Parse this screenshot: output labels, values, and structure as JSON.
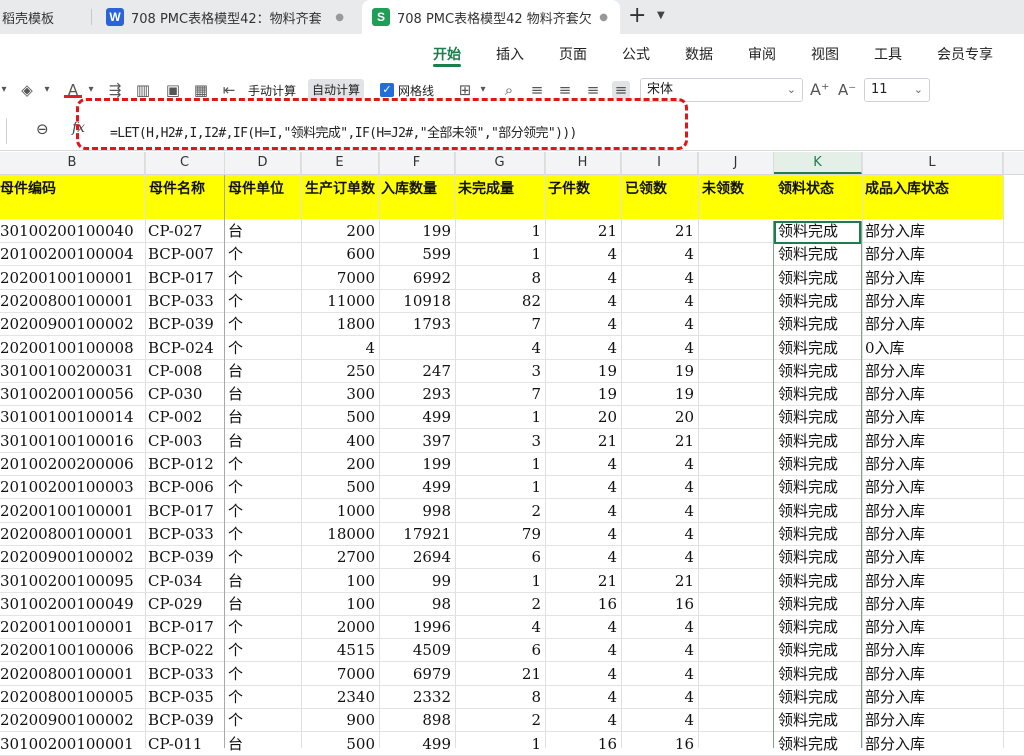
{
  "tabs": [
    {
      "label": "稻壳模板",
      "badge": "",
      "active": false
    },
    {
      "label": "708 PMC表格模型42：物料齐套",
      "badge": "W",
      "badge_color": "#2b63d9",
      "active": false
    },
    {
      "label": "708 PMC表格模型42 物料齐套欠",
      "badge": "S",
      "badge_color": "#1e9e57",
      "active": true
    }
  ],
  "menu": [
    "开始",
    "插入",
    "页面",
    "公式",
    "数据",
    "审阅",
    "视图",
    "工具",
    "会员专享"
  ],
  "toolbar": {
    "manual_calc": "手动计算",
    "auto_calc": "自动计算",
    "gridlines": "网格线",
    "font_name": "宋体",
    "font_size": "11"
  },
  "formula": "=LET(H,H2#,I,I2#,IF(H=I,\"领料完成\",IF(H=J2#,\"全部未领\",\"部分领完\")))",
  "columns": [
    "B",
    "C",
    "D",
    "E",
    "F",
    "G",
    "H",
    "I",
    "J",
    "K",
    "L"
  ],
  "selected_column": "K",
  "headers": [
    "母件编码",
    "母件名称",
    "母件单位",
    "生产订单数",
    "入库数量",
    "未完成量",
    "子件数",
    "已领数",
    "未领数",
    "领料状态",
    "成品入库状态"
  ],
  "rows": [
    [
      "30100200100040",
      "CP-027",
      "台",
      "200",
      "199",
      "1",
      "21",
      "21",
      "",
      "领料完成",
      "部分入库"
    ],
    [
      "20100200100004",
      "BCP-007",
      "个",
      "600",
      "599",
      "1",
      "4",
      "4",
      "",
      "领料完成",
      "部分入库"
    ],
    [
      "20200100100001",
      "BCP-017",
      "个",
      "7000",
      "6992",
      "8",
      "4",
      "4",
      "",
      "领料完成",
      "部分入库"
    ],
    [
      "20200800100001",
      "BCP-033",
      "个",
      "11000",
      "10918",
      "82",
      "4",
      "4",
      "",
      "领料完成",
      "部分入库"
    ],
    [
      "20200900100002",
      "BCP-039",
      "个",
      "1800",
      "1793",
      "7",
      "4",
      "4",
      "",
      "领料完成",
      "部分入库"
    ],
    [
      "20200100100008",
      "BCP-024",
      "个",
      "4",
      "",
      "4",
      "4",
      "4",
      "",
      "领料完成",
      "0入库"
    ],
    [
      "30100100200031",
      "CP-008",
      "台",
      "250",
      "247",
      "3",
      "19",
      "19",
      "",
      "领料完成",
      "部分入库"
    ],
    [
      "30100200100056",
      "CP-030",
      "台",
      "300",
      "293",
      "7",
      "19",
      "19",
      "",
      "领料完成",
      "部分入库"
    ],
    [
      "30100100100014",
      "CP-002",
      "台",
      "500",
      "499",
      "1",
      "20",
      "20",
      "",
      "领料完成",
      "部分入库"
    ],
    [
      "30100100100016",
      "CP-003",
      "台",
      "400",
      "397",
      "3",
      "21",
      "21",
      "",
      "领料完成",
      "部分入库"
    ],
    [
      "20100200200006",
      "BCP-012",
      "个",
      "200",
      "199",
      "1",
      "4",
      "4",
      "",
      "领料完成",
      "部分入库"
    ],
    [
      "20100200100003",
      "BCP-006",
      "个",
      "500",
      "499",
      "1",
      "4",
      "4",
      "",
      "领料完成",
      "部分入库"
    ],
    [
      "20200100100001",
      "BCP-017",
      "个",
      "1000",
      "998",
      "2",
      "4",
      "4",
      "",
      "领料完成",
      "部分入库"
    ],
    [
      "20200800100001",
      "BCP-033",
      "个",
      "18000",
      "17921",
      "79",
      "4",
      "4",
      "",
      "领料完成",
      "部分入库"
    ],
    [
      "20200900100002",
      "BCP-039",
      "个",
      "2700",
      "2694",
      "6",
      "4",
      "4",
      "",
      "领料完成",
      "部分入库"
    ],
    [
      "30100200100095",
      "CP-034",
      "台",
      "100",
      "99",
      "1",
      "21",
      "21",
      "",
      "领料完成",
      "部分入库"
    ],
    [
      "30100200100049",
      "CP-029",
      "台",
      "100",
      "98",
      "2",
      "16",
      "16",
      "",
      "领料完成",
      "部分入库"
    ],
    [
      "20200100100001",
      "BCP-017",
      "个",
      "2000",
      "1996",
      "4",
      "4",
      "4",
      "",
      "领料完成",
      "部分入库"
    ],
    [
      "20200100100006",
      "BCP-022",
      "个",
      "4515",
      "4509",
      "6",
      "4",
      "4",
      "",
      "领料完成",
      "部分入库"
    ],
    [
      "20200800100001",
      "BCP-033",
      "个",
      "7000",
      "6979",
      "21",
      "4",
      "4",
      "",
      "领料完成",
      "部分入库"
    ],
    [
      "20200800100005",
      "BCP-035",
      "个",
      "2340",
      "2332",
      "8",
      "4",
      "4",
      "",
      "领料完成",
      "部分入库"
    ],
    [
      "20200900100002",
      "BCP-039",
      "个",
      "900",
      "898",
      "2",
      "4",
      "4",
      "",
      "领料完成",
      "部分入库"
    ],
    [
      "30100200100001",
      "CP-011",
      "台",
      "500",
      "499",
      "1",
      "16",
      "16",
      "",
      "领料完成",
      "部分入库"
    ]
  ]
}
